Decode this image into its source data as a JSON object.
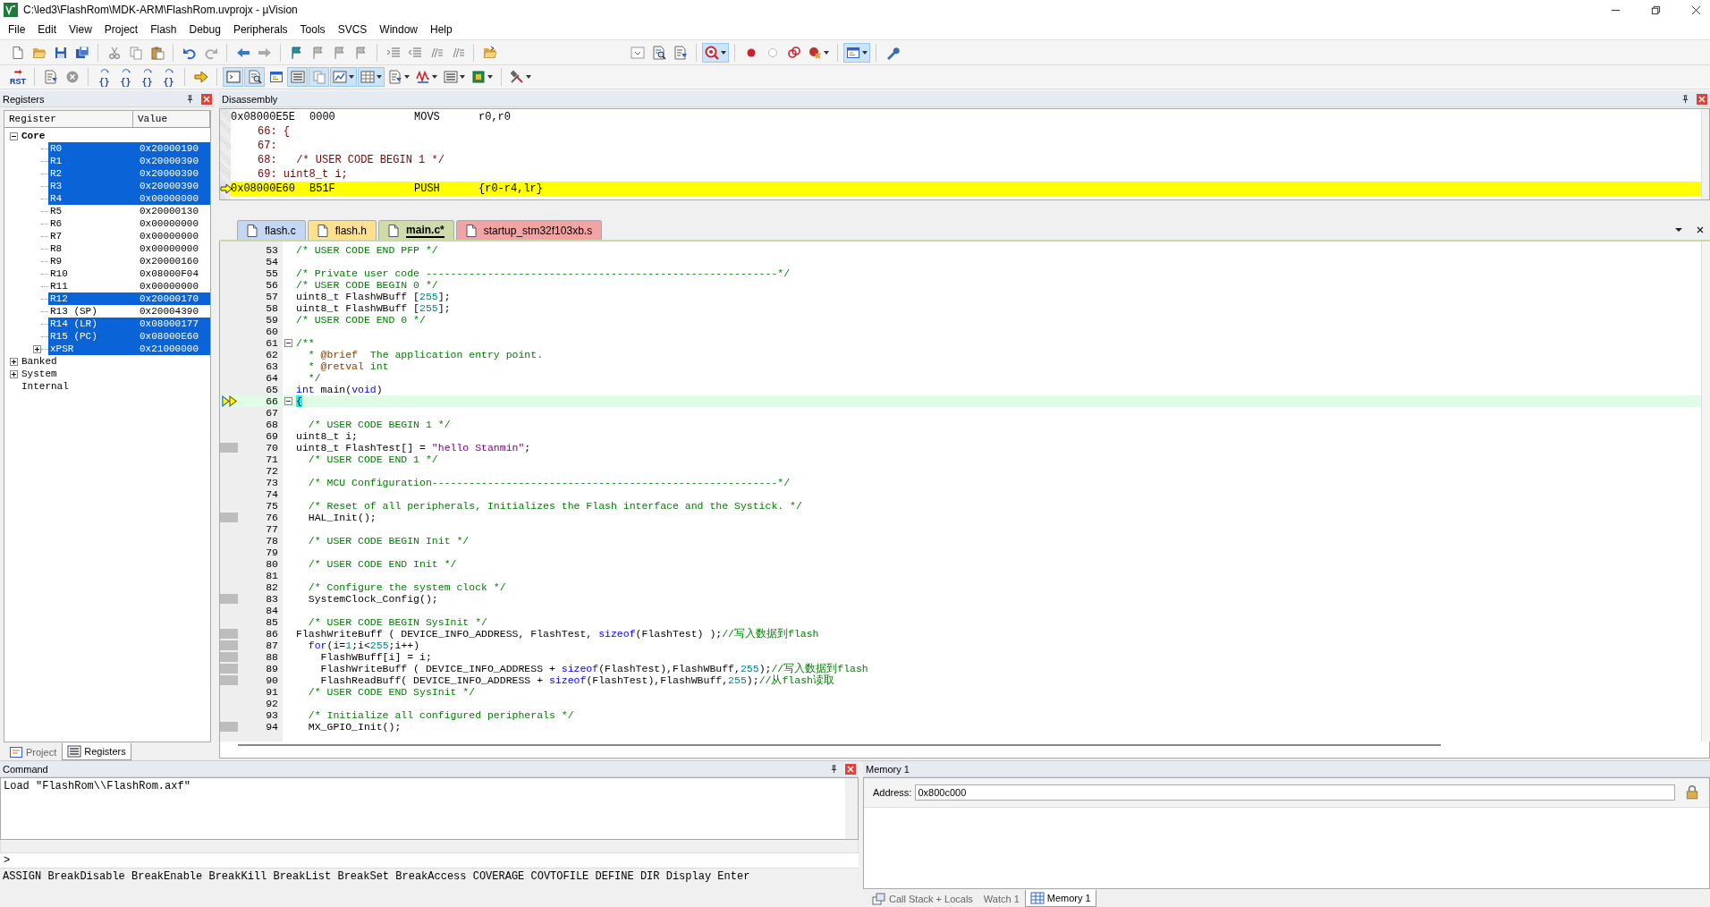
{
  "window": {
    "title": "C:\\led3\\FlashRom\\MDK-ARM\\FlashRom.uvprojx - µVision"
  },
  "menu": [
    "File",
    "Edit",
    "View",
    "Project",
    "Flash",
    "Debug",
    "Peripherals",
    "Tools",
    "SVCS",
    "Window",
    "Help"
  ],
  "toolbar_1_left": [
    {
      "kind": "new-file",
      "selected": false
    },
    {
      "kind": "open",
      "selected": false
    },
    {
      "kind": "save",
      "selected": false
    },
    {
      "kind": "save-all",
      "selected": false
    },
    {
      "kind": "sep"
    },
    {
      "kind": "cut",
      "selected": false
    },
    {
      "kind": "copy",
      "selected": false
    },
    {
      "kind": "paste",
      "selected": false
    },
    {
      "kind": "sep"
    },
    {
      "kind": "undo",
      "selected": false
    },
    {
      "kind": "redo",
      "selected": false
    },
    {
      "kind": "sep"
    },
    {
      "kind": "back",
      "selected": false
    },
    {
      "kind": "forward",
      "selected": false
    },
    {
      "kind": "sep"
    },
    {
      "kind": "bookmark",
      "selected": false
    },
    {
      "kind": "bookmark-grey",
      "selected": false
    },
    {
      "kind": "bookmark-grey",
      "selected": false
    },
    {
      "kind": "bookmark-grey",
      "selected": false
    },
    {
      "kind": "sep"
    },
    {
      "kind": "indent",
      "selected": false
    },
    {
      "kind": "outdent",
      "selected": false
    },
    {
      "kind": "comment",
      "selected": false
    },
    {
      "kind": "comment",
      "selected": false
    },
    {
      "kind": "sep"
    },
    {
      "kind": "folder",
      "selected": false
    }
  ],
  "toolbar_1_right": [
    {
      "kind": "combo",
      "selected": false
    },
    {
      "kind": "find-doc",
      "selected": false
    },
    {
      "kind": "doc-arrow",
      "selected": false
    },
    {
      "kind": "sep"
    },
    {
      "kind": "debug",
      "selected": true,
      "dropdown": true
    },
    {
      "kind": "sep"
    },
    {
      "kind": "breakpoint",
      "selected": false
    },
    {
      "kind": "bp-hollow",
      "selected": false
    },
    {
      "kind": "bp-rings",
      "selected": false
    },
    {
      "kind": "bp-cross",
      "selected": false,
      "dropdown": true
    },
    {
      "kind": "sep"
    },
    {
      "kind": "window",
      "selected": true,
      "dropdown": true
    },
    {
      "kind": "sep"
    },
    {
      "kind": "wrench",
      "selected": false
    }
  ],
  "toolbar_2": [
    {
      "kind": "reset",
      "label": "RST",
      "selected": false
    },
    {
      "kind": "sep"
    },
    {
      "kind": "doc-arrow",
      "selected": false
    },
    {
      "kind": "stop",
      "selected": false
    },
    {
      "kind": "sep"
    },
    {
      "kind": "step",
      "label": "{}",
      "selected": false
    },
    {
      "kind": "step",
      "label": "{}",
      "selected": false
    },
    {
      "kind": "step",
      "label": "{}",
      "selected": false
    },
    {
      "kind": "step",
      "label": "{}",
      "selected": false
    },
    {
      "kind": "sep"
    },
    {
      "kind": "arrow",
      "selected": false
    },
    {
      "kind": "sep"
    },
    {
      "kind": "console",
      "selected": true
    },
    {
      "kind": "find-doc",
      "selected": true
    },
    {
      "kind": "window",
      "selected": false
    },
    {
      "kind": "list",
      "selected": true
    },
    {
      "kind": "copy",
      "selected": true
    },
    {
      "kind": "chart",
      "selected": true,
      "dropdown": true
    },
    {
      "kind": "grid",
      "selected": true,
      "dropdown": true
    },
    {
      "kind": "doc-arrow",
      "selected": false,
      "dropdown": true
    },
    {
      "kind": "wave",
      "selected": false,
      "dropdown": true
    },
    {
      "kind": "list",
      "selected": false,
      "dropdown": true
    },
    {
      "kind": "chip",
      "selected": false,
      "dropdown": true
    },
    {
      "kind": "sep"
    },
    {
      "kind": "tools",
      "selected": false,
      "dropdown": true
    }
  ],
  "registers": {
    "title": "Registers",
    "columns": [
      "Register",
      "Value"
    ],
    "tree": [
      {
        "name": "Core",
        "expanded": true,
        "selected": false,
        "children": [
          {
            "name": "R0",
            "value": "0x20000190",
            "selected": true
          },
          {
            "name": "R1",
            "value": "0x20000390",
            "selected": true
          },
          {
            "name": "R2",
            "value": "0x20000390",
            "selected": true
          },
          {
            "name": "R3",
            "value": "0x20000390",
            "selected": true
          },
          {
            "name": "R4",
            "value": "0x00000000",
            "selected": true
          },
          {
            "name": "R5",
            "value": "0x20000130",
            "selected": false
          },
          {
            "name": "R6",
            "value": "0x00000000",
            "selected": false
          },
          {
            "name": "R7",
            "value": "0x00000000",
            "selected": false
          },
          {
            "name": "R8",
            "value": "0x00000000",
            "selected": false
          },
          {
            "name": "R9",
            "value": "0x20000160",
            "selected": false
          },
          {
            "name": "R10",
            "value": "0x08000F04",
            "selected": false
          },
          {
            "name": "R11",
            "value": "0x00000000",
            "selected": false
          },
          {
            "name": "R12",
            "value": "0x20000170",
            "selected": true
          },
          {
            "name": "R13 (SP)",
            "value": "0x20004390",
            "selected": false
          },
          {
            "name": "R14 (LR)",
            "value": "0x08000177",
            "selected": true
          },
          {
            "name": "R15 (PC)",
            "value": "0x08000E60",
            "selected": true
          },
          {
            "name": "xPSR",
            "value": "0x21000000",
            "selected": true,
            "expanded": false
          }
        ]
      },
      {
        "name": "Banked",
        "expanded": false,
        "selected": false
      },
      {
        "name": "System",
        "expanded": false,
        "selected": false
      },
      {
        "name": "Internal",
        "selected": false
      }
    ],
    "tabs": [
      {
        "label": "Project",
        "selected": false
      },
      {
        "label": "Registers",
        "selected": true
      }
    ]
  },
  "disassembly": {
    "title": "Disassembly",
    "lines": [
      {
        "kind": "asm",
        "address": "0x08000E5E",
        "opcode": "0000",
        "mnemonic": "MOVS",
        "operands": "r0,r0",
        "current": false
      },
      {
        "kind": "src",
        "text": "66: {",
        "current": false
      },
      {
        "kind": "src",
        "text": "67:",
        "current": false
      },
      {
        "kind": "src",
        "text": "68:   /* USER CODE BEGIN 1 */",
        "current": false
      },
      {
        "kind": "src",
        "text": "69: uint8_t i;",
        "current": false
      },
      {
        "kind": "asm",
        "address": "0x08000E60",
        "opcode": "B51F",
        "mnemonic": "PUSH",
        "operands": "{r0-r4,lr}",
        "current": true
      }
    ]
  },
  "editor_tabs": [
    {
      "label": "flash.c",
      "color": "#c5d6f2",
      "selected": false
    },
    {
      "label": "flash.h",
      "color": "#ffe08c",
      "selected": false
    },
    {
      "label": "main.c*",
      "color": "#cfdcaa",
      "selected": true
    },
    {
      "label": "startup_stm32f103xb.s",
      "color": "#f2a3a3",
      "selected": false
    }
  ],
  "code": [
    {
      "number": "53",
      "tokens": [
        {
          "kind": "comment",
          "text": "/* USER CODE END PFP */"
        }
      ]
    },
    {
      "number": "54"
    },
    {
      "number": "55",
      "tokens": [
        {
          "kind": "comment",
          "text": "/* Private user code ---------------------------------------------------------*/"
        }
      ]
    },
    {
      "number": "56",
      "tokens": [
        {
          "kind": "comment",
          "text": "/* USER CODE BEGIN 0 */"
        }
      ]
    },
    {
      "number": "57",
      "tokens": [
        {
          "kind": "plain",
          "text": "uint8_t FlashWBuff ["
        },
        {
          "kind": "number",
          "text": "255"
        },
        {
          "kind": "plain",
          "text": "];"
        }
      ]
    },
    {
      "number": "58",
      "tokens": [
        {
          "kind": "plain",
          "text": "uint8_t FlashWBuff ["
        },
        {
          "kind": "number",
          "text": "255"
        },
        {
          "kind": "plain",
          "text": "];"
        }
      ]
    },
    {
      "number": "59",
      "tokens": [
        {
          "kind": "comment",
          "text": "/* USER CODE END 0 */"
        }
      ]
    },
    {
      "number": "60"
    },
    {
      "number": "61",
      "fold": true,
      "tokens": [
        {
          "kind": "comment",
          "text": "/**"
        }
      ]
    },
    {
      "number": "62",
      "tokens": [
        {
          "kind": "comment",
          "text": "  * "
        },
        {
          "kind": "tag",
          "text": "@brief"
        },
        {
          "kind": "comment",
          "text": "  The application entry point."
        }
      ]
    },
    {
      "number": "63",
      "tokens": [
        {
          "kind": "comment",
          "text": "  * "
        },
        {
          "kind": "tag",
          "text": "@retval"
        },
        {
          "kind": "comment",
          "text": " int"
        }
      ]
    },
    {
      "number": "64",
      "tokens": [
        {
          "kind": "comment",
          "text": "  */"
        }
      ]
    },
    {
      "number": "65",
      "tokens": [
        {
          "kind": "keyword",
          "text": "int"
        },
        {
          "kind": "plain",
          "text": " main("
        },
        {
          "kind": "keyword",
          "text": "void"
        },
        {
          "kind": "plain",
          "text": ")"
        }
      ]
    },
    {
      "number": "66",
      "fold": true,
      "current": true,
      "tokens": [
        {
          "kind": "brace-match",
          "text": "{"
        }
      ]
    },
    {
      "number": "67"
    },
    {
      "number": "68",
      "tokens": [
        {
          "kind": "comment",
          "text": "  /* USER CODE BEGIN 1 */"
        }
      ]
    },
    {
      "number": "69",
      "tokens": [
        {
          "kind": "plain",
          "text": "uint8_t i;"
        }
      ]
    },
    {
      "number": "70",
      "executable": true,
      "tokens": [
        {
          "kind": "plain",
          "text": "uint8_t FlashTest[] = "
        },
        {
          "kind": "string",
          "text": "\"hello Stanmin\""
        },
        {
          "kind": "plain",
          "text": ";"
        }
      ]
    },
    {
      "number": "71",
      "tokens": [
        {
          "kind": "comment",
          "text": "  /* USER CODE END 1 */"
        }
      ]
    },
    {
      "number": "72"
    },
    {
      "number": "73",
      "tokens": [
        {
          "kind": "comment",
          "text": "  /* MCU Configuration--------------------------------------------------------*/"
        }
      ]
    },
    {
      "number": "74"
    },
    {
      "number": "75",
      "tokens": [
        {
          "kind": "comment",
          "text": "  /* Reset of all peripherals, Initializes the Flash interface and the Systick. */"
        }
      ]
    },
    {
      "number": "76",
      "executable": true,
      "tokens": [
        {
          "kind": "plain",
          "text": "  HAL_Init();"
        }
      ]
    },
    {
      "number": "77"
    },
    {
      "number": "78",
      "tokens": [
        {
          "kind": "comment",
          "text": "  /* USER CODE BEGIN Init */"
        }
      ]
    },
    {
      "number": "79"
    },
    {
      "number": "80",
      "tokens": [
        {
          "kind": "comment",
          "text": "  /* USER CODE END Init */"
        }
      ]
    },
    {
      "number": "81"
    },
    {
      "number": "82",
      "tokens": [
        {
          "kind": "comment",
          "text": "  /* Configure the system clock */"
        }
      ]
    },
    {
      "number": "83",
      "executable": true,
      "tokens": [
        {
          "kind": "plain",
          "text": "  SystemClock_Config();"
        }
      ]
    },
    {
      "number": "84"
    },
    {
      "number": "85",
      "tokens": [
        {
          "kind": "comment",
          "text": "  /* USER CODE BEGIN SysInit */"
        }
      ]
    },
    {
      "number": "86",
      "executable": true,
      "tokens": [
        {
          "kind": "plain",
          "text": "FlashWriteBuff ( DEVICE_INFO_ADDRESS, FlashTest, "
        },
        {
          "kind": "keyword",
          "text": "sizeof"
        },
        {
          "kind": "plain",
          "text": "(FlashTest) );"
        },
        {
          "kind": "comment",
          "text": "//写入数据到flash"
        }
      ]
    },
    {
      "number": "87",
      "executable": true,
      "tokens": [
        {
          "kind": "keyword",
          "text": "  for"
        },
        {
          "kind": "plain",
          "text": "(i="
        },
        {
          "kind": "number",
          "text": "1"
        },
        {
          "kind": "plain",
          "text": ";i<"
        },
        {
          "kind": "number",
          "text": "255"
        },
        {
          "kind": "plain",
          "text": ";i++)"
        }
      ]
    },
    {
      "number": "88",
      "executable": true,
      "tokens": [
        {
          "kind": "plain",
          "text": "    FlashWBuff[i] = i;"
        }
      ]
    },
    {
      "number": "89",
      "executable": true,
      "tokens": [
        {
          "kind": "plain",
          "text": "    FlashWriteBuff ( DEVICE_INFO_ADDRESS + "
        },
        {
          "kind": "keyword",
          "text": "sizeof"
        },
        {
          "kind": "plain",
          "text": "(FlashTest),FlashWBuff,"
        },
        {
          "kind": "number",
          "text": "255"
        },
        {
          "kind": "plain",
          "text": ");"
        },
        {
          "kind": "comment",
          "text": "//写入数据到flash"
        }
      ]
    },
    {
      "number": "90",
      "executable": true,
      "tokens": [
        {
          "kind": "plain",
          "text": "    FlashReadBuff( DEVICE_INFO_ADDRESS + "
        },
        {
          "kind": "keyword",
          "text": "sizeof"
        },
        {
          "kind": "plain",
          "text": "(FlashTest),FlashWBuff,"
        },
        {
          "kind": "number",
          "text": "255"
        },
        {
          "kind": "plain",
          "text": ");"
        },
        {
          "kind": "comment",
          "text": "//从flash读取"
        }
      ]
    },
    {
      "number": "91",
      "tokens": [
        {
          "kind": "comment",
          "text": "  /* USER CODE END SysInit */"
        }
      ]
    },
    {
      "number": "92"
    },
    {
      "number": "93",
      "tokens": [
        {
          "kind": "comment",
          "text": "  /* Initialize all configured peripherals */"
        }
      ]
    },
    {
      "number": "94",
      "executable": true,
      "tokens": [
        {
          "kind": "plain",
          "text": "  MX_GPIO_Init();"
        }
      ]
    }
  ],
  "command": {
    "title": "Command",
    "output": "Load \"FlashRom\\\\FlashRom.axf\"",
    "prompt": ">",
    "hints": "ASSIGN BreakDisable BreakEnable BreakKill BreakList BreakSet BreakAccess COVERAGE COVTOFILE DEFINE DIR Display Enter"
  },
  "memory": {
    "title": "Memory 1",
    "address_label": "Address:",
    "address": "0x800c000",
    "tabs": [
      {
        "label": "Call Stack + Locals",
        "selected": false
      },
      {
        "label": "Watch 1",
        "selected": false
      },
      {
        "label": "Memory 1",
        "selected": true
      }
    ]
  }
}
